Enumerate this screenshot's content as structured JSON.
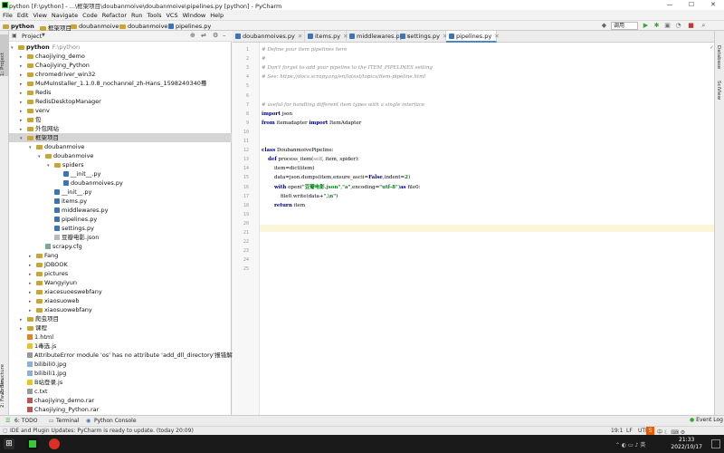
{
  "window": {
    "title": "python [F:\\python] - ...\\框架项目\\doubanmoive\\doubanmoive\\pipelines.py [python] - PyCharm",
    "minimize": "—",
    "maximize": "☐",
    "close": "✕"
  },
  "menu": [
    "File",
    "Edit",
    "View",
    "Navigate",
    "Code",
    "Refactor",
    "Run",
    "Tools",
    "VCS",
    "Window",
    "Help"
  ],
  "breadcrumbs": [
    "python",
    "框架项目",
    "doubanmoive",
    "doubanmoive",
    "pipelines.py"
  ],
  "run_config": "调用",
  "left_strip": {
    "project": "1: Project",
    "structure": "Z: Structure",
    "favorites": "2: Favorites"
  },
  "right_strip": {
    "database": "Database",
    "sciview": "SciView"
  },
  "project_panel": {
    "header": "Project",
    "rows": [
      {
        "label": "python",
        "extra": "F:\\python",
        "level": 0,
        "arrow": "▾",
        "type": "folder",
        "bold": true
      },
      {
        "label": "chaojiying_demo",
        "level": 1,
        "arrow": "▸",
        "type": "folder"
      },
      {
        "label": "Chaojiying_Python",
        "level": 1,
        "arrow": "▸",
        "type": "folder"
      },
      {
        "label": "chromedriver_win32",
        "level": 1,
        "arrow": "▸",
        "type": "folder"
      },
      {
        "label": "MuMuInstaller_1.1.0.8_nochannel_zh-Hans_1598240340蓦",
        "level": 1,
        "arrow": "▸",
        "type": "folder"
      },
      {
        "label": "Redis",
        "level": 1,
        "arrow": "▸",
        "type": "folder"
      },
      {
        "label": "RedisDesktopManager",
        "level": 1,
        "arrow": "▸",
        "type": "folder"
      },
      {
        "label": "venv",
        "level": 1,
        "arrow": "▸",
        "type": "folder"
      },
      {
        "label": "包",
        "level": 1,
        "arrow": "▸",
        "type": "folder"
      },
      {
        "label": "外包网站",
        "level": 1,
        "arrow": "▸",
        "type": "folder"
      },
      {
        "label": "框架项目",
        "level": 1,
        "arrow": "▾",
        "type": "folder",
        "selected": true
      },
      {
        "label": "doubanmoive",
        "level": 2,
        "arrow": "▾",
        "type": "folder"
      },
      {
        "label": "doubanmoive",
        "level": 3,
        "arrow": "▾",
        "type": "folder"
      },
      {
        "label": "spiders",
        "level": 4,
        "arrow": "▾",
        "type": "folder"
      },
      {
        "label": "__init__.py",
        "level": 5,
        "arrow": "",
        "type": "py"
      },
      {
        "label": "doubanmoives.py",
        "level": 5,
        "arrow": "",
        "type": "py"
      },
      {
        "label": "__init__.py",
        "level": 4,
        "arrow": "",
        "type": "py"
      },
      {
        "label": "items.py",
        "level": 4,
        "arrow": "",
        "type": "py"
      },
      {
        "label": "middlewares.py",
        "level": 4,
        "arrow": "",
        "type": "py"
      },
      {
        "label": "pipelines.py",
        "level": 4,
        "arrow": "",
        "type": "py"
      },
      {
        "label": "settings.py",
        "level": 4,
        "arrow": "",
        "type": "py"
      },
      {
        "label": "豆瓣电影.json",
        "level": 4,
        "arrow": "",
        "type": "json"
      },
      {
        "label": "scrapy.cfg",
        "level": 3,
        "arrow": "",
        "type": "cfg"
      },
      {
        "label": "Fang",
        "level": 2,
        "arrow": "▸",
        "type": "folder"
      },
      {
        "label": "JDBOOK",
        "level": 2,
        "arrow": "▸",
        "type": "folder"
      },
      {
        "label": "pictures",
        "level": 2,
        "arrow": "▸",
        "type": "folder"
      },
      {
        "label": "Wangyiyun",
        "level": 2,
        "arrow": "▸",
        "type": "folder"
      },
      {
        "label": "xiacesuoeswebfany",
        "level": 2,
        "arrow": "▸",
        "type": "folder"
      },
      {
        "label": "xiaosuoweb",
        "level": 2,
        "arrow": "▸",
        "type": "folder"
      },
      {
        "label": "xiaosuowebfany",
        "level": 2,
        "arrow": "▸",
        "type": "folder"
      },
      {
        "label": "爬虫项目",
        "level": 1,
        "arrow": "▸",
        "type": "folder"
      },
      {
        "label": "课程",
        "level": 1,
        "arrow": "▸",
        "type": "folder"
      },
      {
        "label": "1.html",
        "level": 1,
        "arrow": "",
        "type": "html"
      },
      {
        "label": "1毒选.js",
        "level": 1,
        "arrow": "",
        "type": "js"
      },
      {
        "label": "AttributeError module 'os' has no attribute 'add_dll_directory'报错解决方法.txt",
        "level": 1,
        "arrow": "",
        "type": "txt"
      },
      {
        "label": "bilibili0.jpg",
        "level": 1,
        "arrow": "",
        "type": "img"
      },
      {
        "label": "bilibili1.jpg",
        "level": 1,
        "arrow": "",
        "type": "img"
      },
      {
        "label": "B站登录.js",
        "level": 1,
        "arrow": "",
        "type": "js"
      },
      {
        "label": "c.txt",
        "level": 1,
        "arrow": "",
        "type": "txt"
      },
      {
        "label": "chaojiying_demo.rar",
        "level": 1,
        "arrow": "",
        "type": "rar"
      },
      {
        "label": "Chaojiying_Python.rar",
        "level": 1,
        "arrow": "",
        "type": "rar"
      }
    ]
  },
  "tabs": [
    {
      "label": "doubanmoives.py",
      "active": false
    },
    {
      "label": "items.py",
      "active": false
    },
    {
      "label": "middlewares.py",
      "active": false
    },
    {
      "label": "settings.py",
      "active": false
    },
    {
      "label": "pipelines.py",
      "active": true
    }
  ],
  "code_lines": [
    {
      "n": "1",
      "html": "<span class='cm'># Define your item pipelines here</span>"
    },
    {
      "n": "2",
      "html": "<span class='cm'>#</span>"
    },
    {
      "n": "3",
      "html": "<span class='cm'># Don't forget to add your pipeline to the ITEM_PIPELINES setting</span>"
    },
    {
      "n": "4",
      "html": "<span class='cm'># See: https://docs.scrapy.org/en/latest/topics/item-pipeline.html</span>"
    },
    {
      "n": "5",
      "html": ""
    },
    {
      "n": "6",
      "html": ""
    },
    {
      "n": "7",
      "html": "<span class='cm'># useful for handling different item types with a single interface</span>"
    },
    {
      "n": "8",
      "html": "<span class='kw'>import</span> json"
    },
    {
      "n": "9",
      "html": "<span class='kw'>from</span> itemadapter <span class='kw'>import</span> ItemAdapter"
    },
    {
      "n": "10",
      "html": ""
    },
    {
      "n": "11",
      "html": ""
    },
    {
      "n": "12",
      "html": "<span class='kw'>class</span> DoubanmoivePipeline:"
    },
    {
      "n": "13",
      "html": "    <span class='kw'>def</span> process_item(<span class='self'>self</span>, item, spider):"
    },
    {
      "n": "14",
      "html": "        item=dict(item)"
    },
    {
      "n": "15",
      "html": "        data=json.dumps(item,ensure_ascii=<span class='kw'>False</span>,indent=<span class='str'>2</span>)"
    },
    {
      "n": "16",
      "html": "        <span class='kw'>with</span> open(<span class='str'>\"豆瓣电影.json\"</span>,<span class='str'>\"a\"</span>,encoding=<span class='str'>\"utf-8\"</span>)<span class='kw'>as</span> file0:"
    },
    {
      "n": "17",
      "html": "            file0.write(data+<span class='str'>\",\\n\"</span>)"
    },
    {
      "n": "18",
      "html": "        <span class='kw'>return</span> item"
    },
    {
      "n": "19",
      "html": ""
    },
    {
      "n": "20",
      "html": ""
    },
    {
      "n": "21",
      "html": ""
    },
    {
      "n": "22",
      "html": ""
    },
    {
      "n": "23",
      "html": ""
    },
    {
      "n": "24",
      "html": ""
    },
    {
      "n": "25",
      "html": ""
    }
  ],
  "bottom_tabs": {
    "todo": "6: TODO",
    "terminal": "Terminal",
    "console": "Python Console",
    "eventlog": "Event Log"
  },
  "status": {
    "message": "IDE and Plugin Updates: PyCharm is ready to update. (today 20:09)",
    "position": "19:1",
    "lf": "LF",
    "encoding": "UTF-8"
  },
  "clock": {
    "time": "21:33",
    "date": "2022/10/17"
  }
}
